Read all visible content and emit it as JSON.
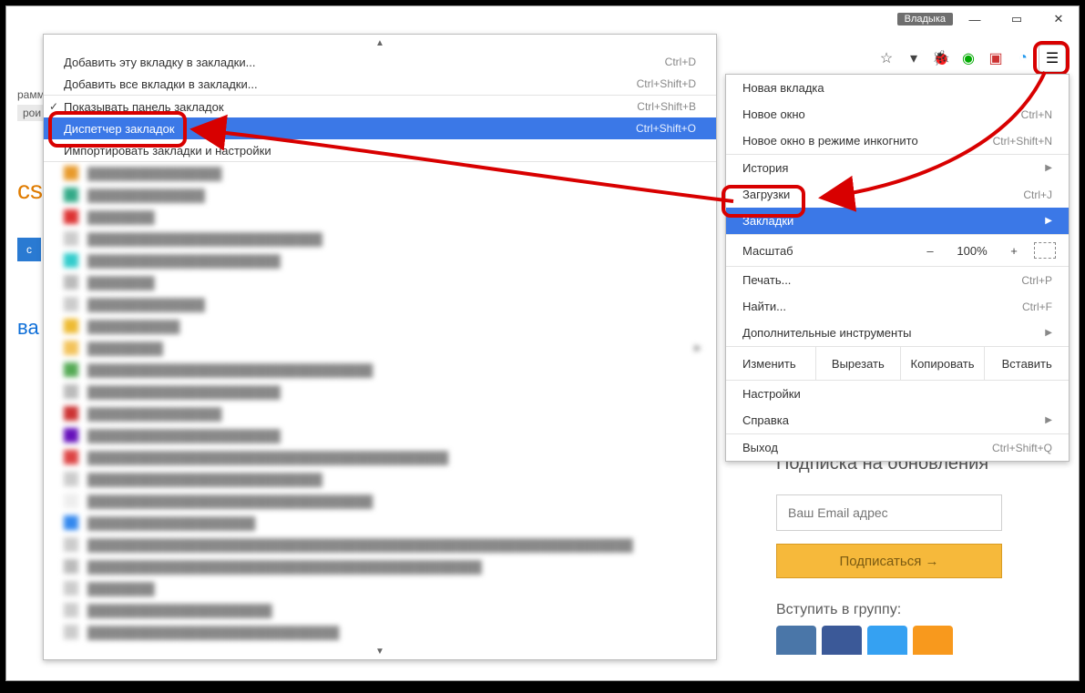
{
  "titlebar": {
    "user": "Владыка"
  },
  "submenu": {
    "items": [
      {
        "label": "Добавить эту вкладку в закладки...",
        "shortcut": "Ctrl+D"
      },
      {
        "label": "Добавить все вкладки в закладки...",
        "shortcut": "Ctrl+Shift+D"
      }
    ],
    "show_bar": {
      "label": "Показывать панель закладок",
      "shortcut": "Ctrl+Shift+B",
      "checked": true
    },
    "manager": {
      "label": "Диспетчер закладок",
      "shortcut": "Ctrl+Shift+O"
    },
    "import": {
      "label": "Импортировать закладки и настройки"
    }
  },
  "mainmenu": {
    "new_tab": {
      "label": "Новая вкладка"
    },
    "new_win": {
      "label": "Новое окно",
      "shortcut": "Ctrl+N"
    },
    "incognito": {
      "label": "Новое окно в режиме инкогнито",
      "shortcut": "Ctrl+Shift+N"
    },
    "history": {
      "label": "История"
    },
    "downloads": {
      "label": "Загрузки",
      "shortcut": "Ctrl+J"
    },
    "bookmarks": {
      "label": "Закладки"
    },
    "zoom": {
      "label": "Масштаб",
      "value": "100%"
    },
    "print": {
      "label": "Печать...",
      "shortcut": "Ctrl+P"
    },
    "find": {
      "label": "Найти...",
      "shortcut": "Ctrl+F"
    },
    "tools": {
      "label": "Дополнительные инструменты"
    },
    "edit": {
      "label": "Изменить",
      "cut": "Вырезать",
      "copy": "Копировать",
      "paste": "Вставить"
    },
    "settings": {
      "label": "Настройки"
    },
    "help": {
      "label": "Справка"
    },
    "exit": {
      "label": "Выход",
      "shortcut": "Ctrl+Shift+Q"
    }
  },
  "page": {
    "frag1": "рамми",
    "frag2": "рои",
    "logo_suffix": "cs",
    "snippet": "с",
    "va": "ва"
  },
  "subscribe": {
    "title": "Подписка на обновления",
    "placeholder": "Ваш Email адрес",
    "button": "Подписаться →",
    "join": "Вступить в группу:"
  }
}
